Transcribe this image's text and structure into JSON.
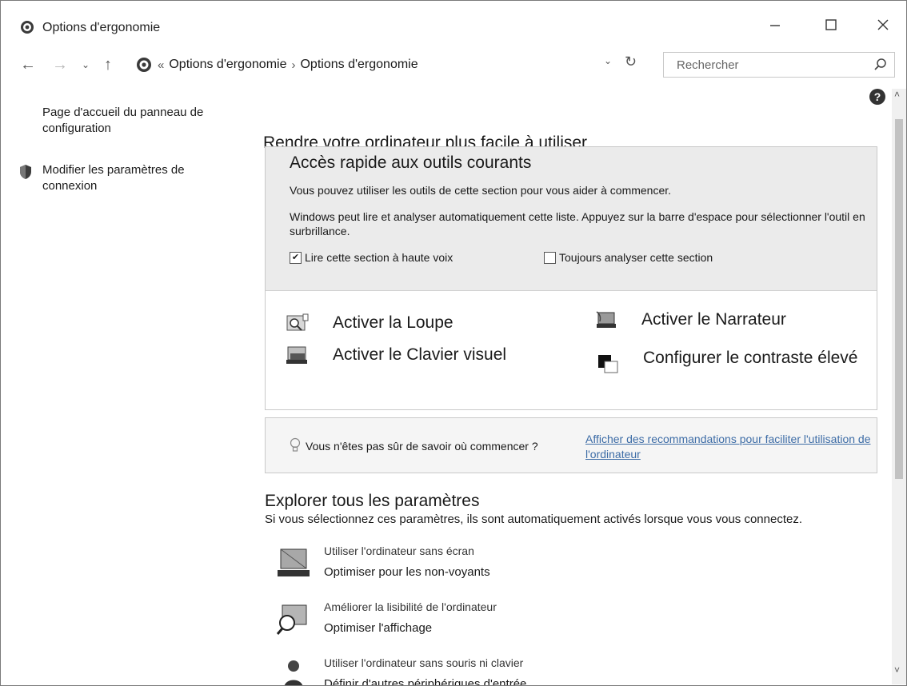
{
  "window": {
    "title": "Options d'ergonomie"
  },
  "nav": {
    "breadcrumb_prefix": "«",
    "breadcrumb": [
      "Options d'ergonomie",
      "Options d'ergonomie"
    ],
    "breadcrumb_separator": "›",
    "search_placeholder": "Rechercher"
  },
  "sidebar": {
    "home": "Page d'accueil du panneau de configuration",
    "modify": "Modifier les paramètres de connexion"
  },
  "main": {
    "title": "Rendre votre ordinateur plus facile à utiliser",
    "quick": {
      "title": "Accès rapide aux outils courants",
      "desc1": "Vous pouvez utiliser les outils de cette section pour vous aider à commencer.",
      "desc2": "Windows peut lire et analyser automatiquement cette liste. Appuyez sur la barre d'espace pour sélectionner l'outil en surbrillance.",
      "check_read": {
        "label": "Lire cette section à haute voix",
        "checked": true
      },
      "check_scan": {
        "label": "Toujours analyser cette section",
        "checked": false
      },
      "tools": {
        "loupe": "Activer la Loupe",
        "clavier": "Activer le Clavier visuel",
        "narrateur": "Activer le Narrateur",
        "contraste": "Configurer le contraste élevé"
      }
    },
    "hint": {
      "question": "Vous n'êtes pas sûr de savoir où commencer ?",
      "link": "Afficher des recommandations pour faciliter l'utilisation de l'ordinateur"
    },
    "explore": {
      "title": "Explorer tous les paramètres",
      "desc": "Si vous sélectionnez ces paramètres, ils sont automatiquement activés lorsque vous vous connectez.",
      "items": [
        {
          "line1": "Utiliser l'ordinateur sans écran",
          "line2": "Optimiser pour les non-voyants"
        },
        {
          "line1": "Améliorer la lisibilité de l'ordinateur",
          "line2": "Optimiser l'affichage"
        },
        {
          "line1": "Utiliser l'ordinateur sans souris ni clavier",
          "line2": "Définir d'autres périphériques d'entrée"
        }
      ]
    }
  },
  "colors": {
    "link": "#3d6ca6",
    "panel_bg": "#ebebeb"
  }
}
